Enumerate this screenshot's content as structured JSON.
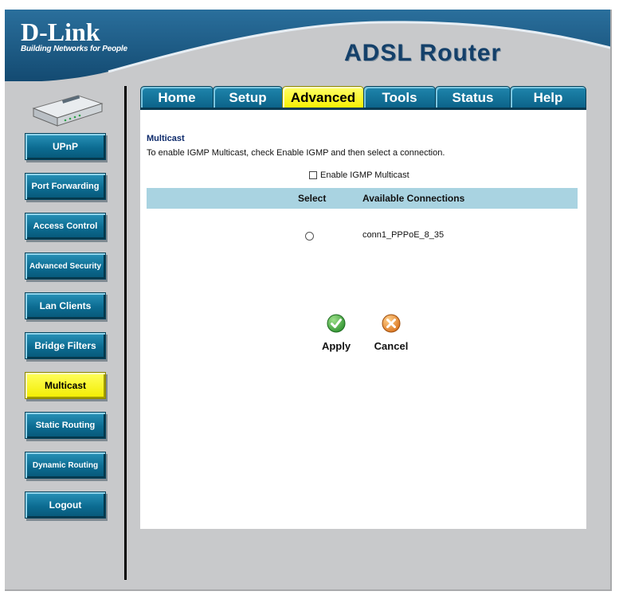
{
  "header": {
    "logo_brand": "D-Link",
    "logo_tagline": "Building Networks for People",
    "product_title": "ADSL Router",
    "colors": {
      "banner": "#1d5a85",
      "product_text": "#14406a"
    }
  },
  "tabs": [
    {
      "label": "Home",
      "active": false
    },
    {
      "label": "Setup",
      "active": false
    },
    {
      "label": "Advanced",
      "active": true
    },
    {
      "label": "Tools",
      "active": false
    },
    {
      "label": "Status",
      "active": false
    },
    {
      "label": "Help",
      "active": false
    }
  ],
  "sidebar": {
    "image": "router-device-image",
    "items": [
      {
        "label": "UPnP",
        "active": false
      },
      {
        "label": "Port Forwarding",
        "active": false
      },
      {
        "label": "Access Control",
        "active": false
      },
      {
        "label": "Advanced Security",
        "active": false
      },
      {
        "label": "Lan Clients",
        "active": false
      },
      {
        "label": "Bridge Filters",
        "active": false
      },
      {
        "label": "Multicast",
        "active": true
      },
      {
        "label": "Static Routing",
        "active": false
      },
      {
        "label": "Dynamic Routing",
        "active": false
      },
      {
        "label": "Logout",
        "active": false
      }
    ],
    "colors": {
      "button": "#0c6c92",
      "active_button": "#f2ec00"
    }
  },
  "main": {
    "section_title": "Multicast",
    "description": "To enable IGMP Multicast, check Enable IGMP and then select a connection.",
    "enable_igmp": {
      "label": "Enable IGMP Multicast",
      "checked": false
    },
    "table": {
      "headers": {
        "select": "Select",
        "connections": "Available Connections"
      },
      "rows": [
        {
          "selected": false,
          "connection": "conn1_PPPoE_8_35"
        }
      ]
    },
    "actions": {
      "apply": {
        "label": "Apply",
        "icon": "check-icon",
        "color": "#3aa537"
      },
      "cancel": {
        "label": "Cancel",
        "icon": "cancel-x-icon",
        "color": "#e58a1e"
      }
    }
  }
}
